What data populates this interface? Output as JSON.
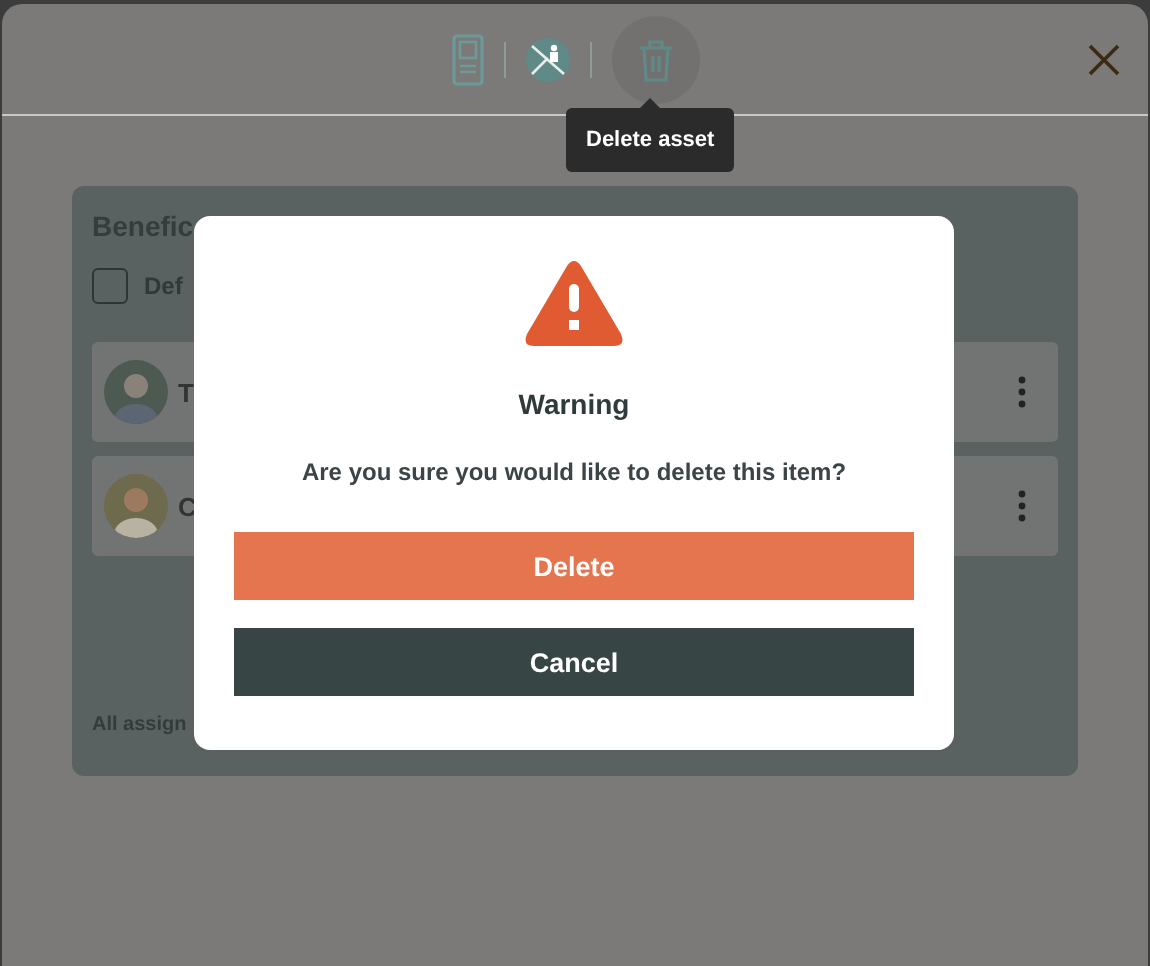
{
  "toolbar": {
    "tooltip": "Delete asset"
  },
  "card": {
    "title": "Benefic",
    "checkbox": {
      "label": "Def",
      "checked": false
    },
    "rows": [
      {
        "name": "T"
      },
      {
        "name": "C"
      }
    ],
    "footer": "All assign"
  },
  "dialog": {
    "title": "Warning",
    "message": "Are you sure you would like to delete this item?",
    "buttons": [
      {
        "label": "Delete",
        "kind": "danger"
      },
      {
        "label": "Cancel",
        "kind": "neutral"
      }
    ]
  }
}
